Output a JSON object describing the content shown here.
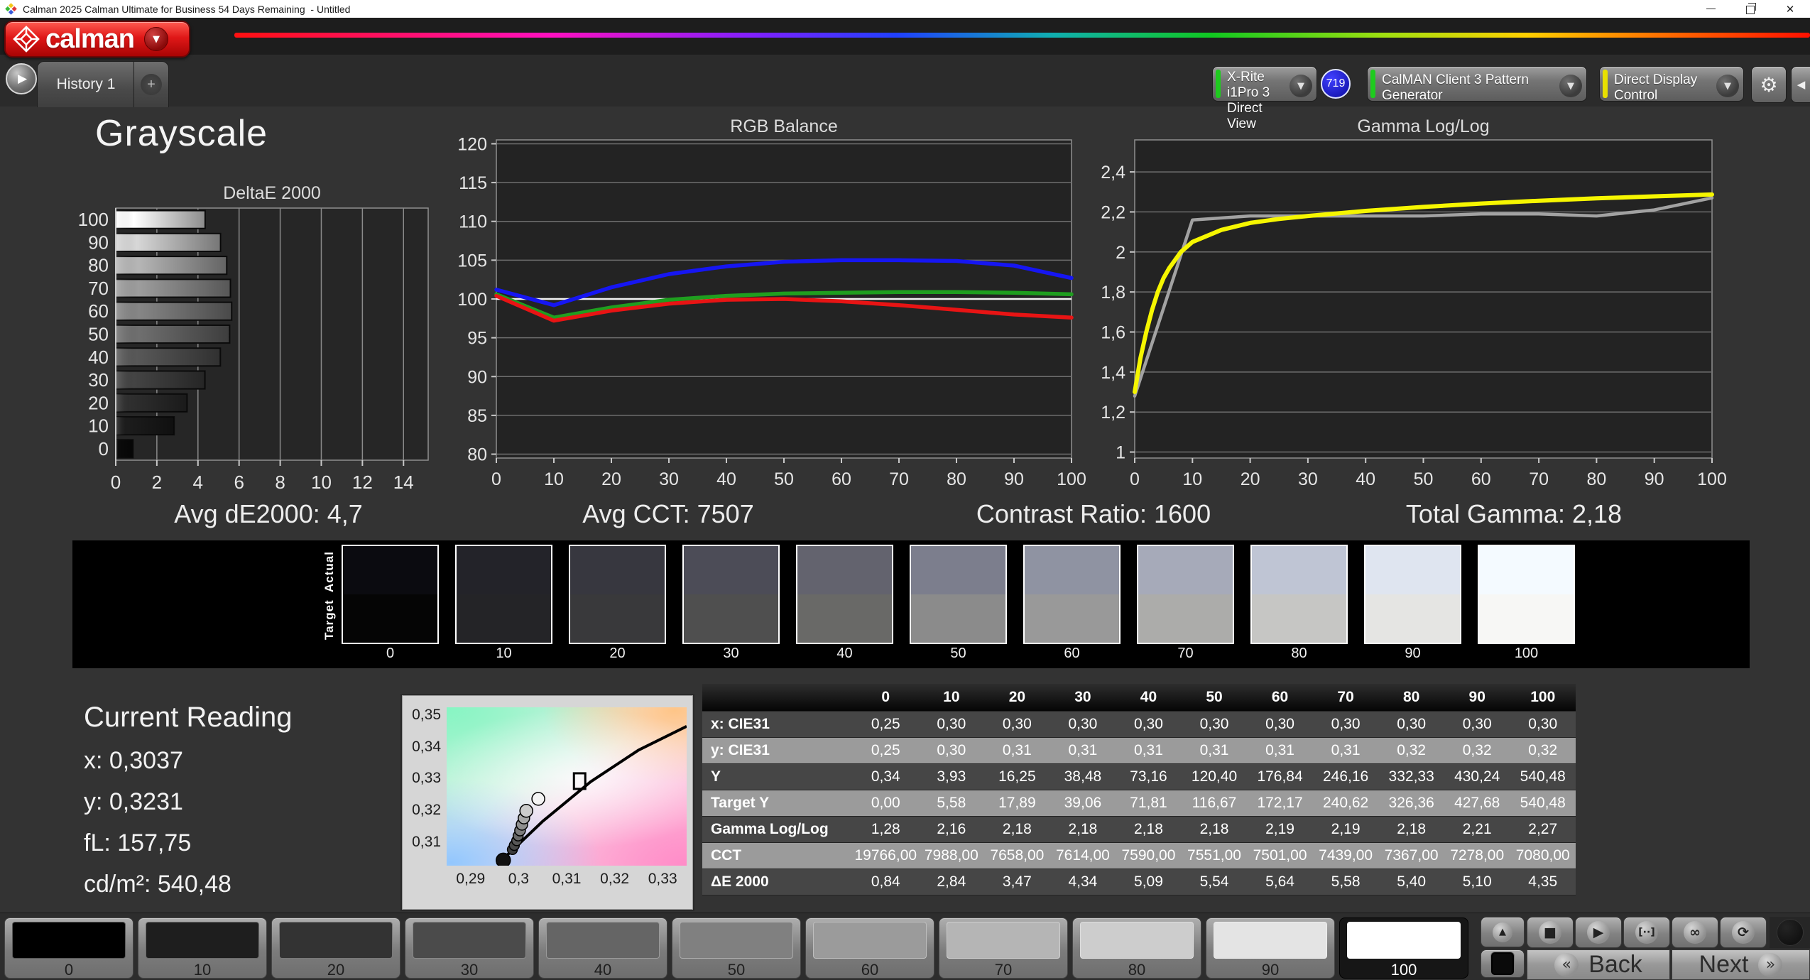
{
  "window": {
    "title": "Calman 2025 Calman Ultimate for Business 54 Days Remaining  - Untitled",
    "controls": [
      "minimize-icon",
      "restore-icon",
      "close-icon"
    ]
  },
  "brand": {
    "logo_text": "calman",
    "logo_color": "#d41414"
  },
  "toolbar": {
    "history_tab": "History 1",
    "add_tab": "+",
    "meter_dropdown": {
      "line1": "X-Rite i1Pro 3",
      "line2": "Direct View",
      "accent": "#1ecb1e"
    },
    "meter_badge": "719",
    "pattern_generator_dropdown": {
      "label": "CalMAN Client 3 Pattern Generator",
      "accent": "#1ecb1e"
    },
    "display_control_dropdown": {
      "label": "Direct Display Control",
      "accent": "#e8e000"
    },
    "gear_icon": "⚙",
    "side_collapse_icon": "◀",
    "play_icon": "▶",
    "dropdown_chevron": "▼"
  },
  "page_title": "Grayscale",
  "summary": {
    "avg_de2000": "Avg dE2000: 4,7",
    "avg_cct": "Avg CCT: 7507",
    "contrast_ratio": "Contrast Ratio: 1600",
    "total_gamma": "Total Gamma: 2,18"
  },
  "chart_data": {
    "deltae": {
      "type": "bar",
      "title": "DeltaE 2000",
      "categories": [
        "0",
        "10",
        "20",
        "30",
        "40",
        "50",
        "60",
        "70",
        "80",
        "90",
        "100"
      ],
      "values": [
        0.84,
        2.84,
        3.47,
        4.34,
        5.09,
        5.54,
        5.64,
        5.58,
        5.4,
        5.1,
        4.35
      ],
      "xticks": [
        "0",
        "2",
        "4",
        "6",
        "8",
        "10",
        "12",
        "14"
      ],
      "xlim": [
        0,
        15.2
      ],
      "bar_tones": [
        "#0a0a0a",
        "#1c1c1c",
        "#2f2f2f",
        "#444444",
        "#585858",
        "#6f6f6f",
        "#868686",
        "#9d9d9d",
        "#b6b6b6",
        "#d7d7d7",
        "#ffffff"
      ]
    },
    "rgb_balance": {
      "type": "line",
      "title": "RGB Balance",
      "x": [
        0,
        10,
        20,
        30,
        40,
        50,
        60,
        70,
        80,
        90,
        100
      ],
      "xticks": [
        "0",
        "10",
        "20",
        "30",
        "40",
        "50",
        "60",
        "70",
        "80",
        "90",
        "100"
      ],
      "ylim": [
        79.5,
        120.5
      ],
      "yticks": [
        80,
        85,
        90,
        95,
        100,
        105,
        110,
        115,
        120
      ],
      "ytick_labels": [
        "80",
        "85",
        "90",
        "95",
        "100",
        "105",
        "110",
        "115",
        "120"
      ],
      "ref_line": 100,
      "series": [
        {
          "name": "blue",
          "color": "#1616f2",
          "values": [
            101.2,
            99.2,
            101.5,
            103.2,
            104.2,
            104.8,
            105.0,
            105.0,
            104.9,
            104.3,
            102.7
          ]
        },
        {
          "name": "green",
          "color": "#1f9e1f",
          "values": [
            100.6,
            97.6,
            98.9,
            99.9,
            100.4,
            100.7,
            100.8,
            100.9,
            100.9,
            100.8,
            100.6
          ]
        },
        {
          "name": "red",
          "color": "#e81414",
          "values": [
            100.4,
            97.2,
            98.5,
            99.4,
            99.9,
            100.0,
            99.7,
            99.2,
            98.6,
            98.0,
            97.6
          ]
        }
      ]
    },
    "gamma": {
      "type": "line",
      "title": "Gamma Log/Log",
      "xticks": [
        "0",
        "10",
        "20",
        "30",
        "40",
        "50",
        "60",
        "70",
        "80",
        "90",
        "100"
      ],
      "ylim": [
        0.97,
        2.56
      ],
      "yticks": [
        1,
        1.2,
        1.4,
        1.6,
        1.8,
        2,
        2.2,
        2.4
      ],
      "ytick_labels": [
        "1",
        "1,2",
        "1,4",
        "1,6",
        "1,8",
        "2",
        "2,2",
        "2,4"
      ],
      "series": [
        {
          "name": "measured",
          "color": "#a2a2a2",
          "width": 4.5,
          "x": [
            0,
            10,
            20,
            30,
            40,
            50,
            60,
            70,
            80,
            90,
            100
          ],
          "values": [
            1.28,
            2.16,
            2.18,
            2.18,
            2.18,
            2.18,
            2.19,
            2.19,
            2.18,
            2.21,
            2.27
          ]
        },
        {
          "name": "target",
          "color": "#f6f600",
          "width": 6,
          "x": [
            0,
            1,
            2,
            3,
            4,
            5,
            6,
            8,
            10,
            15,
            20,
            25,
            30,
            40,
            50,
            60,
            70,
            80,
            90,
            100
          ],
          "values": [
            1.3,
            1.47,
            1.6,
            1.71,
            1.8,
            1.87,
            1.92,
            2.0,
            2.05,
            2.11,
            2.145,
            2.165,
            2.18,
            2.205,
            2.225,
            2.242,
            2.256,
            2.268,
            2.278,
            2.287
          ]
        }
      ]
    },
    "cie": {
      "type": "scatter",
      "xlim": [
        0.285,
        0.335
      ],
      "ylim": [
        0.3025,
        0.3525
      ],
      "xticks": [
        {
          "v": 0.29,
          "label": "0,29"
        },
        {
          "v": 0.3,
          "label": "0,3"
        },
        {
          "v": 0.31,
          "label": "0,31"
        },
        {
          "v": 0.32,
          "label": "0,32"
        },
        {
          "v": 0.33,
          "label": "0,33"
        }
      ],
      "yticks": [
        {
          "v": 0.31,
          "label": "0,31"
        },
        {
          "v": 0.32,
          "label": "0,32"
        },
        {
          "v": 0.33,
          "label": "0,33"
        },
        {
          "v": 0.34,
          "label": "0,34"
        },
        {
          "v": 0.35,
          "label": "0,35"
        }
      ],
      "locus": [
        [
          0.2955,
          0.3028
        ],
        [
          0.305,
          0.3165
        ],
        [
          0.315,
          0.329
        ],
        [
          0.325,
          0.339
        ],
        [
          0.335,
          0.3465
        ]
      ],
      "target": {
        "x": 0.3127,
        "y": 0.3292
      },
      "samples": [
        {
          "x": 0.2968,
          "y": 0.3042,
          "fill": "#111111",
          "r": 10
        },
        {
          "x": 0.2987,
          "y": 0.3076,
          "fill": "#3c3c3c",
          "r": 7
        },
        {
          "x": 0.2991,
          "y": 0.3089,
          "fill": "#484848",
          "r": 7
        },
        {
          "x": 0.2996,
          "y": 0.3104,
          "fill": "#575757",
          "r": 7
        },
        {
          "x": 0.2999,
          "y": 0.3119,
          "fill": "#686868",
          "r": 7
        },
        {
          "x": 0.3003,
          "y": 0.3136,
          "fill": "#7b7b7b",
          "r": 7.5
        },
        {
          "x": 0.3007,
          "y": 0.3155,
          "fill": "#8f8f8f",
          "r": 8
        },
        {
          "x": 0.3011,
          "y": 0.3175,
          "fill": "#a8a8a8",
          "r": 8
        },
        {
          "x": 0.3016,
          "y": 0.3198,
          "fill": "#cccccc",
          "r": 9
        },
        {
          "x": 0.3041,
          "y": 0.3236,
          "fill": "#f4f4f4",
          "r": 9
        }
      ]
    }
  },
  "swatch_strip": {
    "actual_label": "Actual",
    "target_label": "Target",
    "levels": [
      "0",
      "10",
      "20",
      "30",
      "40",
      "50",
      "60",
      "70",
      "80",
      "90",
      "100"
    ],
    "actual_colors": [
      "#0b0b10",
      "#232329",
      "#37373f",
      "#4c4c57",
      "#63636e",
      "#7c7e8d",
      "#8f93a2",
      "#a6aab9",
      "#bfc5d4",
      "#dfe5f0",
      "#f4faff"
    ],
    "target_colors": [
      "#050505",
      "#242427",
      "#39393b",
      "#4f4f4f",
      "#696967",
      "#8b8b8b",
      "#999999",
      "#acacaa",
      "#c6c6c4",
      "#e5e5e3",
      "#f7f7f5"
    ]
  },
  "current_reading": {
    "title": "Current Reading",
    "lines": [
      "x: 0,3037",
      "y: 0,3231",
      "fL: 157,75",
      "cd/m²: 540,48"
    ]
  },
  "table": {
    "columns": [
      "",
      "0",
      "10",
      "20",
      "30",
      "40",
      "50",
      "60",
      "70",
      "80",
      "90",
      "100"
    ],
    "rows": [
      {
        "label": "x: CIE31",
        "values": [
          "0,25",
          "0,30",
          "0,30",
          "0,30",
          "0,30",
          "0,30",
          "0,30",
          "0,30",
          "0,30",
          "0,30",
          "0,30"
        ]
      },
      {
        "label": "y: CIE31",
        "values": [
          "0,25",
          "0,30",
          "0,31",
          "0,31",
          "0,31",
          "0,31",
          "0,31",
          "0,31",
          "0,32",
          "0,32",
          "0,32"
        ]
      },
      {
        "label": "Y",
        "values": [
          "0,34",
          "3,93",
          "16,25",
          "38,48",
          "73,16",
          "120,40",
          "176,84",
          "246,16",
          "332,33",
          "430,24",
          "540,48"
        ]
      },
      {
        "label": "Target Y",
        "values": [
          "0,00",
          "5,58",
          "17,89",
          "39,06",
          "71,81",
          "116,67",
          "172,17",
          "240,62",
          "326,36",
          "427,68",
          "540,48"
        ]
      },
      {
        "label": "Gamma Log/Log",
        "values": [
          "1,28",
          "2,16",
          "2,18",
          "2,18",
          "2,18",
          "2,18",
          "2,19",
          "2,19",
          "2,18",
          "2,21",
          "2,27"
        ]
      },
      {
        "label": "CCT",
        "values": [
          "19766,00",
          "7988,00",
          "7658,00",
          "7614,00",
          "7590,00",
          "7551,00",
          "7501,00",
          "7439,00",
          "7367,00",
          "7278,00",
          "7080,00"
        ]
      },
      {
        "label": "ΔE 2000",
        "values": [
          "0,84",
          "2,84",
          "3,47",
          "4,34",
          "5,09",
          "5,54",
          "5,64",
          "5,58",
          "5,40",
          "5,10",
          "4,35"
        ]
      }
    ]
  },
  "pattern_bar": {
    "levels": [
      "0",
      "10",
      "20",
      "30",
      "40",
      "50",
      "60",
      "70",
      "80",
      "90",
      "100"
    ],
    "tones": [
      "#000000",
      "#1e1e1e",
      "#333333",
      "#4b4b4b",
      "#656565",
      "#808080",
      "#9b9b9b",
      "#b5b5b5",
      "#cdcdcd",
      "#e4e4e4",
      "#ffffff"
    ],
    "selected": "100",
    "up_icon": "▲",
    "transport": [
      {
        "name": "stop",
        "glyph": "■"
      },
      {
        "name": "play",
        "glyph": "▶"
      },
      {
        "name": "step",
        "glyph": "[··]"
      },
      {
        "name": "loop",
        "glyph": "∞"
      },
      {
        "name": "refresh",
        "glyph": "⟳"
      }
    ],
    "back_label": "Back",
    "next_label": "Next",
    "back_icon": "«",
    "next_icon": "»"
  }
}
